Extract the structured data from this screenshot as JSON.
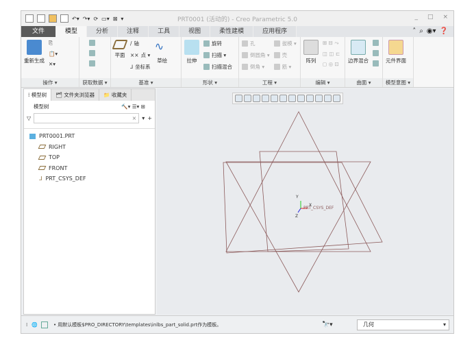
{
  "window": {
    "title": "PRT0001 (活动的) - Creo Parametric 5.0",
    "controls": [
      "_",
      "□",
      "×"
    ]
  },
  "tabs": [
    "文件",
    "模型",
    "分析",
    "注释",
    "工具",
    "视图",
    "柔性建模",
    "应用程序"
  ],
  "active_tab": "模型",
  "ribbon": {
    "groups": [
      {
        "label": "操作 ▾",
        "big": [
          "重新生成"
        ]
      },
      {
        "label": "获取数据 ▾"
      },
      {
        "label": "基准 ▾",
        "big": [
          "平面",
          "草绘"
        ],
        "small": [
          "轴",
          "点 ▾",
          "坐标系"
        ]
      },
      {
        "label": "形状 ▾",
        "big": [
          "拉伸"
        ],
        "small": [
          "旋转",
          "扫描 ▾",
          "扫描混合"
        ]
      },
      {
        "label": "工程 ▾",
        "small": [
          "孔",
          "倒圆角 ▾",
          "倒角 ▾",
          "拔模 ▾",
          "壳",
          "筋 ▾"
        ]
      },
      {
        "label": "编辑 ▾",
        "big": [
          "阵列"
        ]
      },
      {
        "label": "曲面 ▾",
        "big": [
          "边界混合"
        ]
      },
      {
        "label": "模型意图 ▾",
        "big": [
          "元件界面"
        ]
      }
    ]
  },
  "left_panel": {
    "tabs": [
      "模型树",
      "文件夹浏览器",
      "收藏夹"
    ],
    "header": "模型树",
    "filter_placeholder": "",
    "tree": [
      "PRT0001.PRT",
      "RIGHT",
      "TOP",
      "FRONT",
      "PRT_CSYS_DEF"
    ]
  },
  "graphics": {
    "csys_label": "PRT_CSYS_DEF",
    "axis_labels": [
      "Y",
      "X",
      "Z"
    ],
    "line_color": "#8b5a5a"
  },
  "status": {
    "message": "• 用默认模板$PRO_DIRECTORY\\templates\\inlbs_part_solid.prt作为模板。",
    "filter_value": "几何"
  }
}
